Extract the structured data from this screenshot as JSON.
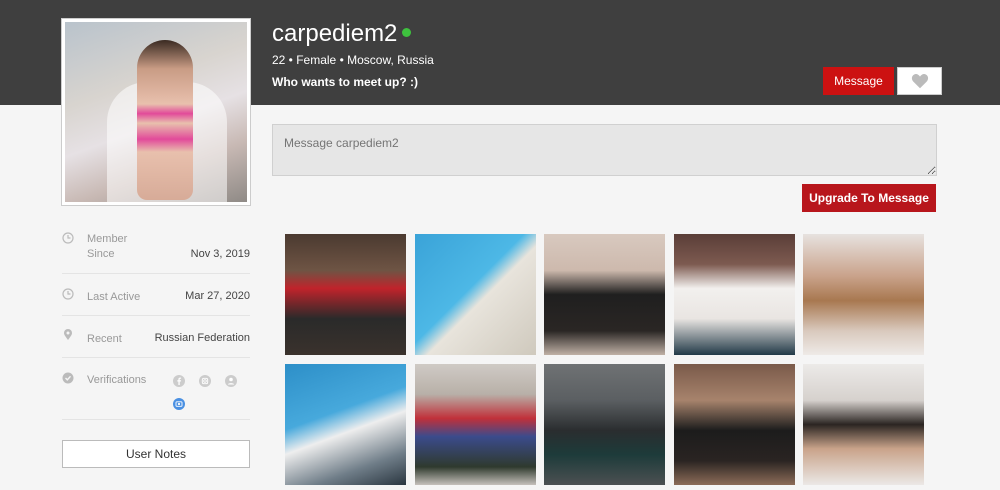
{
  "profile": {
    "username": "carpediem2",
    "meta": "22 • Female • Moscow, Russia",
    "tagline": "Who wants to meet up? :)",
    "online_color": "#3ec13e"
  },
  "actions": {
    "message_label": "Message",
    "favorite_icon": "heart-icon",
    "message_placeholder": "Message carpediem2",
    "upgrade_label": "Upgrade To Message"
  },
  "info": {
    "member_since_label": "Member\nSince",
    "member_since_value": "Nov 3, 2019",
    "last_active_label": "Last Active",
    "last_active_value": "Mar 27, 2020",
    "recent_label": "Recent",
    "recent_value": "Russian Federation",
    "verifications_label": "Verifications"
  },
  "user_notes_label": "User Notes",
  "colors": {
    "header": "#3f3f3f",
    "accent_red": "#cc1111",
    "upgrade_red": "#b8161c"
  },
  "photos": [
    {
      "id": "photo-1"
    },
    {
      "id": "photo-2"
    },
    {
      "id": "photo-3"
    },
    {
      "id": "photo-4"
    },
    {
      "id": "photo-5"
    },
    {
      "id": "photo-6"
    },
    {
      "id": "photo-7"
    },
    {
      "id": "photo-8"
    },
    {
      "id": "photo-9"
    },
    {
      "id": "photo-10"
    }
  ]
}
